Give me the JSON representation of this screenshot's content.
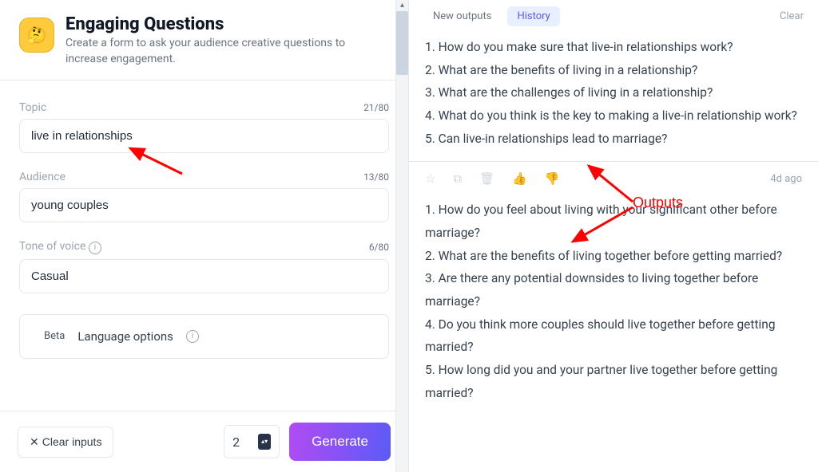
{
  "header": {
    "title": "Engaging Questions",
    "subtitle": "Create a form to ask your audience creative questions to increase engagement."
  },
  "form": {
    "topic": {
      "label": "Topic",
      "counter": "21/80",
      "value": "live in relationships"
    },
    "audience": {
      "label": "Audience",
      "counter": "13/80",
      "value": "young couples"
    },
    "tone": {
      "label": "Tone of voice",
      "counter": "6/80",
      "value": "Casual"
    },
    "lang": {
      "beta": "Beta",
      "label": "Language options"
    }
  },
  "actions": {
    "clear_inputs": "Clear inputs",
    "quantity": "2",
    "generate": "Generate"
  },
  "tabs": {
    "new": "New outputs",
    "history": "History",
    "clear": "Clear"
  },
  "outputs": {
    "block1": [
      "1. How do you make sure that live-in relationships work?",
      "2. What are the benefits of living in a relationship?",
      "3. What are the challenges of living in a relationship?",
      "4. What do you think is the key to making a live-in relationship work?",
      "5. Can live-in relationships lead to marriage?"
    ],
    "time": "4d ago",
    "block2": [
      "1. How do you feel about living with your significant other before marriage?",
      "2. What are the benefits of living together before getting married?",
      "3. Are there any potential downsides to living together before marriage?",
      "4. Do you think more couples should live together before getting married?",
      "5. How long did you and your partner live together before getting married?"
    ]
  },
  "annotation": {
    "label": "Outputs"
  }
}
